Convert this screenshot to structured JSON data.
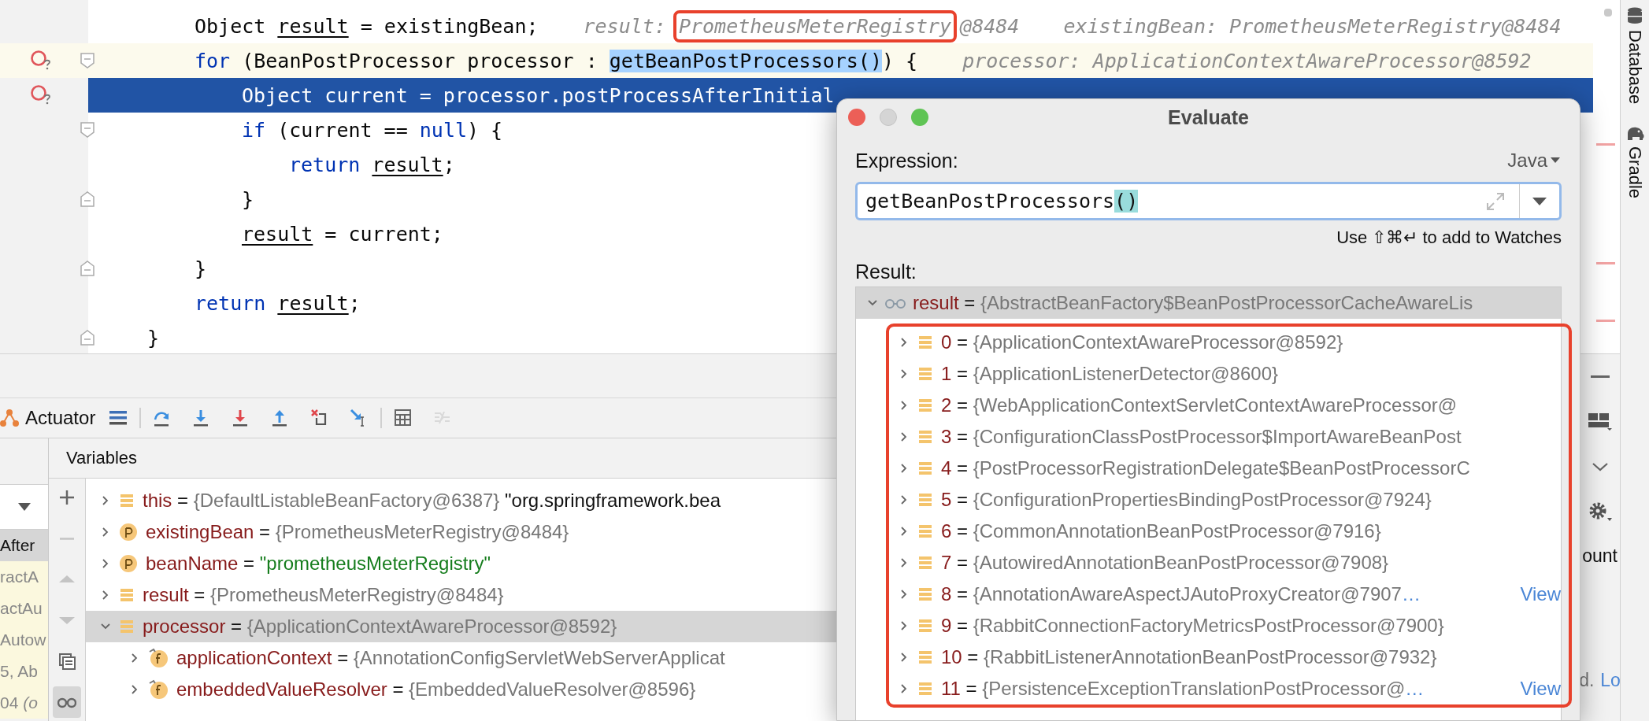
{
  "editor": {
    "lines": [
      {
        "children": [
          {
            "current": false,
            "executing": false,
            "breakpoint": false,
            "fold_open": false,
            "fold_close": false,
            "tokens": [
              {
                "text": "Object ",
                "kind": "plain"
              },
              {
                "text": "result",
                "kind": "var"
              },
              {
                "text": " = existingBean;",
                "kind": "plain"
              }
            ],
            "hints": [
              {
                "text": "result: ",
                "annotated": false
              },
              {
                "text": "PrometheusMeterRegistry",
                "annotated": true
              },
              {
                "text": "@8484",
                "annotated": false
              },
              {
                "text": "existingBean: PrometheusMeterRegistry@8484",
                "annotated": false
              }
            ]
          },
          {
            "current": true,
            "executing": false,
            "breakpoint": true,
            "fold_open": true,
            "fold_close": false,
            "tokens": [
              {
                "text": "for",
                "kind": "kw"
              },
              {
                "text": " (BeanPostProcessor processor : ",
                "kind": "plain"
              },
              {
                "text": "getBeanPostProcessors()",
                "kind": "match"
              },
              {
                "text": ") {",
                "kind": "plain"
              }
            ],
            "hints": [
              {
                "text": "processor: ApplicationContextAwareProcessor@8592",
                "annotated": false
              }
            ],
            "children": [
              {
                "current": false,
                "executing": true,
                "breakpoint": true,
                "fold_open": false,
                "fold_close": false,
                "tokens": [
                  {
                    "text": "Object current = processor.postProcessAfterInitial",
                    "kind": "plain"
                  }
                ]
              },
              {
                "current": false,
                "executing": false,
                "breakpoint": false,
                "fold_open": true,
                "fold_close": false,
                "tokens": [
                  {
                    "text": "if",
                    "kind": "kw"
                  },
                  {
                    "text": " (current == ",
                    "kind": "plain"
                  },
                  {
                    "text": "null",
                    "kind": "kw"
                  },
                  {
                    "text": ") {",
                    "kind": "plain"
                  }
                ],
                "children": [
                  {
                    "current": false,
                    "executing": false,
                    "breakpoint": false,
                    "fold_open": false,
                    "fold_close": false,
                    "tokens": [
                      {
                        "text": "return ",
                        "kind": "kw"
                      },
                      {
                        "text": "result",
                        "kind": "var"
                      },
                      {
                        "text": ";",
                        "kind": "plain"
                      }
                    ]
                  }
                ]
              },
              {
                "current": false,
                "executing": false,
                "breakpoint": false,
                "fold_open": false,
                "fold_close": true,
                "tokens": [
                  {
                    "text": "}",
                    "kind": "plain"
                  }
                ]
              },
              {
                "current": false,
                "executing": false,
                "breakpoint": false,
                "fold_open": false,
                "fold_close": false,
                "tokens": [
                  {
                    "text": "result",
                    "kind": "var"
                  },
                  {
                    "text": " = current;",
                    "kind": "plain"
                  }
                ]
              }
            ]
          },
          {
            "current": false,
            "executing": false,
            "breakpoint": false,
            "fold_open": false,
            "fold_close": true,
            "tokens": [
              {
                "text": "}",
                "kind": "plain"
              }
            ]
          },
          {
            "current": false,
            "executing": false,
            "breakpoint": false,
            "fold_open": false,
            "fold_close": false,
            "tokens": [
              {
                "text": "return ",
                "kind": "kw"
              },
              {
                "text": "result",
                "kind": "var"
              },
              {
                "text": ";",
                "kind": "plain"
              }
            ]
          }
        ]
      },
      {
        "current": false,
        "executing": false,
        "breakpoint": false,
        "fold_open": false,
        "fold_close": true,
        "tokens": [
          {
            "text": "}",
            "kind": "plain"
          }
        ]
      }
    ]
  },
  "debugger": {
    "tab": {
      "label": "Actuator"
    },
    "button_groups": [
      [
        {
          "kind": "layout",
          "disabled": false
        }
      ],
      [
        {
          "kind": "step-over",
          "disabled": false
        },
        {
          "kind": "step-into",
          "disabled": false
        },
        {
          "kind": "force-step-into",
          "disabled": false
        },
        {
          "kind": "step-out",
          "disabled": false
        },
        {
          "kind": "drop-frame",
          "disabled": false
        },
        {
          "kind": "run-to-cursor",
          "disabled": false
        }
      ],
      [
        {
          "kind": "evaluate",
          "disabled": false
        },
        {
          "kind": "trace",
          "disabled": true
        }
      ]
    ],
    "frames": [
      {
        "text": "After",
        "selected": true
      },
      {
        "text": "ractA",
        "selected": false
      },
      {
        "text": "actAu",
        "selected": false
      },
      {
        "text": "Autow",
        "selected": false
      },
      {
        "text": "5, Ab",
        "selected": false
      },
      {
        "text": "04 *(o*",
        "selected": false
      }
    ],
    "variables_title": "Variables",
    "side_buttons": [
      {
        "kind": "add",
        "disabled": false,
        "on": false
      },
      {
        "kind": "remove",
        "disabled": true,
        "on": false
      },
      {
        "kind": "up",
        "disabled": true,
        "on": false
      },
      {
        "kind": "down",
        "disabled": true,
        "on": false
      },
      {
        "kind": "copy",
        "disabled": false,
        "on": false
      },
      {
        "kind": "watches",
        "disabled": false,
        "on": true
      }
    ],
    "variables": [
      {
        "kind": "object",
        "expanded": false,
        "selected": false,
        "parts": [
          {
            "text": "this",
            "kind": "name"
          },
          {
            "text": " = ",
            "kind": "plain"
          },
          {
            "text": "{DefaultListableBeanFactory@6387}",
            "kind": "object"
          },
          {
            "text": " \"org.springframework.bea",
            "kind": "plain"
          }
        ]
      },
      {
        "kind": "param",
        "expanded": false,
        "selected": false,
        "parts": [
          {
            "text": "existingBean",
            "kind": "name"
          },
          {
            "text": " = ",
            "kind": "plain"
          },
          {
            "text": "{PrometheusMeterRegistry@8484}",
            "kind": "object"
          }
        ]
      },
      {
        "kind": "param",
        "expanded": false,
        "selected": false,
        "parts": [
          {
            "text": "beanName",
            "kind": "name"
          },
          {
            "text": " = ",
            "kind": "plain"
          },
          {
            "text": "\"prometheusMeterRegistry\"",
            "kind": "string"
          }
        ]
      },
      {
        "kind": "object",
        "expanded": false,
        "selected": false,
        "parts": [
          {
            "text": "result",
            "kind": "name"
          },
          {
            "text": " = ",
            "kind": "plain"
          },
          {
            "text": "{PrometheusMeterRegistry@8484}",
            "kind": "object"
          }
        ]
      },
      {
        "kind": "object",
        "expanded": true,
        "selected": true,
        "parts": [
          {
            "text": "processor",
            "kind": "name"
          },
          {
            "text": " = ",
            "kind": "plain"
          },
          {
            "text": "{ApplicationContextAwareProcessor@8592}",
            "kind": "object"
          }
        ],
        "children": [
          {
            "kind": "field",
            "expanded": false,
            "selected": false,
            "parts": [
              {
                "text": "applicationContext",
                "kind": "name"
              },
              {
                "text": " = ",
                "kind": "plain"
              },
              {
                "text": "{AnnotationConfigServletWebServerApplicat",
                "kind": "object"
              }
            ]
          },
          {
            "kind": "field",
            "expanded": false,
            "selected": false,
            "parts": [
              {
                "text": "embeddedValueResolver",
                "kind": "name"
              },
              {
                "text": " = ",
                "kind": "plain"
              },
              {
                "text": "{EmbeddedValueResolver@8596}",
                "kind": "object"
              }
            ]
          }
        ]
      }
    ],
    "right_edge": {
      "buttons": [
        {
          "kind": "minimize"
        },
        {
          "kind": "layout"
        },
        {
          "kind": "chevron"
        },
        {
          "kind": "settings"
        }
      ],
      "label": "ount",
      "status": [
        {
          "text": "d.",
          "kind": "plain"
        },
        {
          "text": "Lo",
          "kind": "link"
        }
      ]
    }
  },
  "side_tabs": [
    {
      "label": "Database",
      "kind": "database"
    },
    {
      "label": "Gradle",
      "kind": "gradle"
    }
  ],
  "dialog": {
    "title": "Evaluate",
    "expression_label": "Expression:",
    "language": "Java",
    "expression": [
      {
        "text": "getBeanPostProcessors",
        "kind": "plain"
      },
      {
        "text": "()",
        "kind": "match"
      }
    ],
    "hint": "Use ⇧⌘↵ to add to Watches",
    "result_label": "Result:",
    "result": {
      "kind": "watch",
      "expanded": true,
      "annotated": true,
      "parts": [
        {
          "text": "result",
          "kind": "name"
        },
        {
          "text": " = ",
          "kind": "plain"
        },
        {
          "text": "{AbstractBeanFactory$BeanPostProcessorCacheAwareLis",
          "kind": "object"
        }
      ],
      "children": [
        {
          "expanded": false,
          "parts": [
            {
              "text": "0",
              "kind": "name"
            },
            {
              "text": " = ",
              "kind": "plain"
            },
            {
              "text": "{ApplicationContextAwareProcessor@8592}",
              "kind": "object"
            }
          ]
        },
        {
          "expanded": false,
          "parts": [
            {
              "text": "1",
              "kind": "name"
            },
            {
              "text": " = ",
              "kind": "plain"
            },
            {
              "text": "{ApplicationListenerDetector@8600}",
              "kind": "object"
            }
          ]
        },
        {
          "expanded": false,
          "parts": [
            {
              "text": "2",
              "kind": "name"
            },
            {
              "text": " = ",
              "kind": "plain"
            },
            {
              "text": "{WebApplicationContextServletContextAwareProcessor@",
              "kind": "object"
            }
          ]
        },
        {
          "expanded": false,
          "parts": [
            {
              "text": "3",
              "kind": "name"
            },
            {
              "text": " = ",
              "kind": "plain"
            },
            {
              "text": "{ConfigurationClassPostProcessor$ImportAwareBeanPost",
              "kind": "object"
            }
          ]
        },
        {
          "expanded": false,
          "parts": [
            {
              "text": "4",
              "kind": "name"
            },
            {
              "text": " = ",
              "kind": "plain"
            },
            {
              "text": "{PostProcessorRegistrationDelegate$BeanPostProcessorC",
              "kind": "object"
            }
          ]
        },
        {
          "expanded": false,
          "parts": [
            {
              "text": "5",
              "kind": "name"
            },
            {
              "text": " = ",
              "kind": "plain"
            },
            {
              "text": "{ConfigurationPropertiesBindingPostProcessor@7924}",
              "kind": "object"
            }
          ]
        },
        {
          "expanded": false,
          "parts": [
            {
              "text": "6",
              "kind": "name"
            },
            {
              "text": " = ",
              "kind": "plain"
            },
            {
              "text": "{CommonAnnotationBeanPostProcessor@7916}",
              "kind": "object"
            }
          ]
        },
        {
          "expanded": false,
          "parts": [
            {
              "text": "7",
              "kind": "name"
            },
            {
              "text": " = ",
              "kind": "plain"
            },
            {
              "text": "{AutowiredAnnotationBeanPostProcessor@7908}",
              "kind": "object"
            }
          ]
        },
        {
          "expanded": false,
          "parts": [
            {
              "text": "8",
              "kind": "name"
            },
            {
              "text": " = ",
              "kind": "plain"
            },
            {
              "text": "{AnnotationAwareAspectJAutoProxyCreator@7907",
              "kind": "object"
            },
            {
              "text": "…",
              "kind": "link"
            }
          ],
          "link": "View"
        },
        {
          "expanded": false,
          "parts": [
            {
              "text": "9",
              "kind": "name"
            },
            {
              "text": " = ",
              "kind": "plain"
            },
            {
              "text": "{RabbitConnectionFactoryMetricsPostProcessor@7900}",
              "kind": "object"
            }
          ]
        },
        {
          "expanded": false,
          "parts": [
            {
              "text": "10",
              "kind": "name"
            },
            {
              "text": " = ",
              "kind": "plain"
            },
            {
              "text": "{RabbitListenerAnnotationBeanPostProcessor@7932}",
              "kind": "object"
            }
          ]
        },
        {
          "expanded": false,
          "parts": [
            {
              "text": "11",
              "kind": "name"
            },
            {
              "text": " = ",
              "kind": "plain"
            },
            {
              "text": "{PersistenceExceptionTranslationPostProcessor@",
              "kind": "object"
            },
            {
              "text": "…",
              "kind": "link"
            }
          ],
          "link": "View"
        }
      ]
    }
  }
}
